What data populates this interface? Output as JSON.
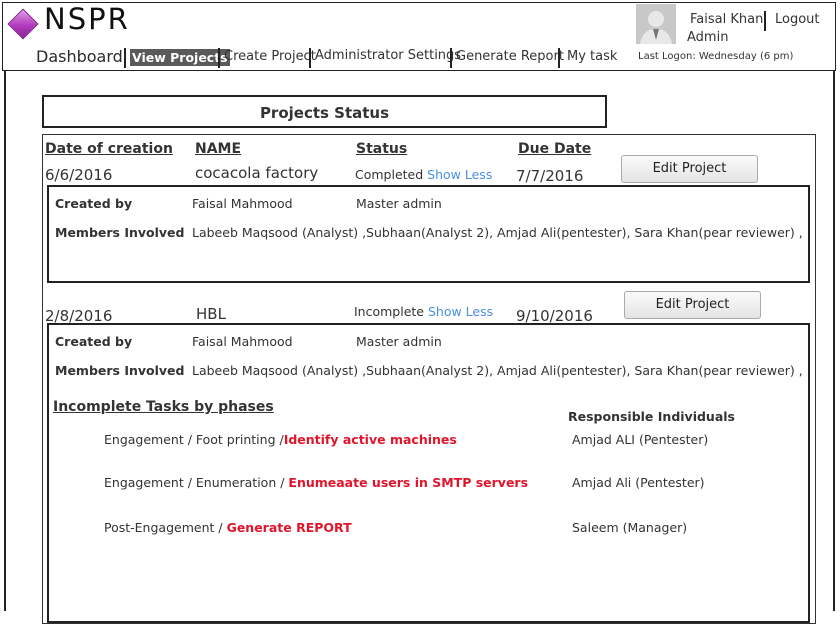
{
  "app": {
    "logo_text": "NSPR"
  },
  "user": {
    "name": "Faisal Khan",
    "logout": "Logout",
    "role": "Admin",
    "last_logon": "Last Logon:  Wednesday (6 pm)"
  },
  "nav": {
    "dashboard": "Dashboard",
    "view_projects": "View Projects",
    "create_project": "Create Project",
    "admin_settings": "Administrator Settings",
    "generate_report": "Generate Report",
    "my_task": "My task"
  },
  "section_title": "Projects Status",
  "columns": {
    "date": "Date of creation",
    "name": "NAME",
    "status": "Status",
    "due": "Due Date"
  },
  "labels": {
    "created_by": "Created by",
    "members": "Members Involved",
    "edit": "Edit Project",
    "show_less": "Show Less"
  },
  "projects": [
    {
      "date": "6/6/2016",
      "name": "cocacola factory",
      "status": "Completed",
      "due": "7/7/2016",
      "created_by": "Faisal Mahmood",
      "creator_role": "Master admin",
      "members": "Labeeb Maqsood (Analyst) ,Subhaan(Analyst 2),  Amjad Ali(pentester), Sara Khan(pear reviewer) ,"
    },
    {
      "date": "2/8/2016",
      "name": "HBL",
      "status": "Incomplete",
      "due": "9/10/2016",
      "created_by": "Faisal Mahmood",
      "creator_role": "Master admin",
      "members": "Labeeb Maqsood (Analyst) ,Subhaan(Analyst 2),  Amjad Ali(pentester), Sara Khan(pear reviewer) ,"
    }
  ],
  "tasks_section": {
    "title": "Incomplete  Tasks by phases",
    "responsible_title": "Responsible Individuals",
    "tasks": [
      {
        "phase": "Engagement  / Foot printing /",
        "task": "Identify active machines",
        "responsible": "Amjad ALI (Pentester)"
      },
      {
        "phase": "Engagement / Enumeration / ",
        "task": "Enumeaate users in SMTP servers",
        "responsible": "Amjad Ali (Pentester)"
      },
      {
        "phase": "Post-Engagement / ",
        "task": "Generate REPORT",
        "responsible": "Saleem (Manager)"
      }
    ]
  },
  "colors": {
    "accent_link": "#4a8fe0",
    "task_red": "#e0152b",
    "logo_purple": "#b23bbd"
  },
  "icons": {
    "logo": "diamond-logo-icon",
    "avatar": "user-avatar-icon"
  }
}
